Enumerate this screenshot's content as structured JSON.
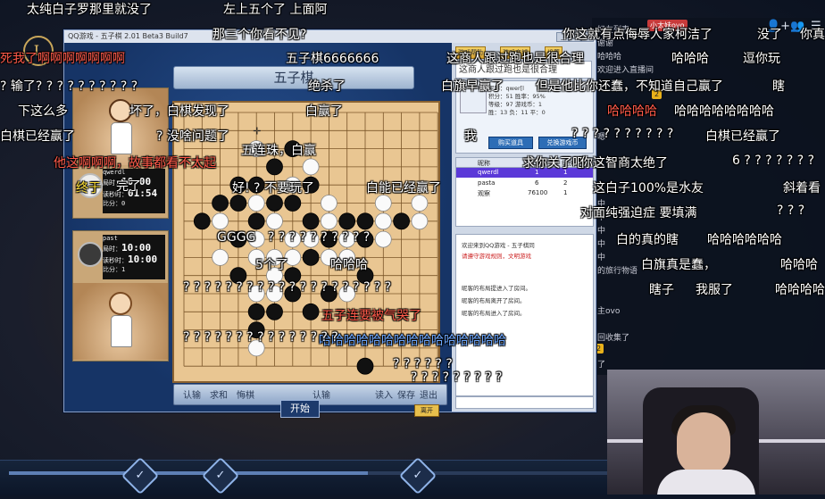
{
  "game": {
    "titlebar": "QQ游戏 - 五子棋  2.01 Beta3 Build7",
    "banner": "五子棋",
    "toolbar": {
      "btn1": "游戏帮助",
      "btn2": "游戏商城",
      "btn3": "设置"
    },
    "ad_text": "这商人跟过跑也是很合理",
    "profile_buttons": [
      "购买道具",
      "兑换游戏币"
    ],
    "profile_lines": [
      "昵称：qwer[l",
      "积分：51  胜率：95%",
      "等级：97  游戏币：1",
      "胜：13  负：11  平：0"
    ],
    "user_list": {
      "headers": [
        "昵称",
        "QQ号",
        "级别"
      ],
      "rows": [
        {
          "name": "qwerdl",
          "qq": "1",
          "lvl": "1"
        },
        {
          "name": "pasta",
          "qq": "6",
          "lvl": "2"
        },
        {
          "name": "观察",
          "qq": "76100",
          "lvl": "1"
        }
      ]
    },
    "messages": [
      "欢迎来到QQ游戏 - 五子棋同",
      "请遵守游戏规则，文明游戏",
      "",
      "昵客的布局提进入了房间。",
      "昵客的布局离开了房间。",
      "昵客的布局进入了房间。"
    ],
    "player_top": {
      "name": "qwerdl",
      "line1": "局时：",
      "time1": "10:00",
      "line2": "读秒时：",
      "time2": "01:54",
      "line3": "比分：0"
    },
    "player_bottom": {
      "name": "past",
      "line1": "局时：",
      "time1": "10:00",
      "line2": "读秒时：",
      "time2": "10:00",
      "line3": "比分：1"
    },
    "bottom_buttons": [
      "认输",
      "求和",
      "悔棋",
      "开始",
      "认输",
      "保存",
      "退出",
      "读入"
    ],
    "start_label": "开始",
    "exit_label": "离开",
    "board_size": 15
  },
  "stones": {
    "black": [
      [
        6,
        2
      ],
      [
        5,
        3
      ],
      [
        3,
        4
      ],
      [
        4,
        4
      ],
      [
        7,
        4
      ],
      [
        2,
        5
      ],
      [
        3,
        5
      ],
      [
        5,
        5
      ],
      [
        6,
        5
      ],
      [
        1,
        6
      ],
      [
        4,
        6
      ],
      [
        7,
        6
      ],
      [
        9,
        6
      ],
      [
        10,
        6
      ],
      [
        12,
        6
      ],
      [
        3,
        7
      ],
      [
        8,
        7
      ],
      [
        10,
        7
      ],
      [
        7,
        8
      ],
      [
        3,
        9
      ],
      [
        6,
        9
      ],
      [
        10,
        9
      ],
      [
        6,
        10
      ],
      [
        8,
        10
      ],
      [
        4,
        11
      ],
      [
        5,
        11
      ],
      [
        7,
        11
      ],
      [
        4,
        12
      ],
      [
        10,
        14
      ],
      [
        10,
        15
      ]
    ],
    "white": [
      [
        4,
        2
      ],
      [
        7,
        3
      ],
      [
        6,
        4
      ],
      [
        4,
        5
      ],
      [
        8,
        5
      ],
      [
        11,
        5
      ],
      [
        13,
        5
      ],
      [
        2,
        6
      ],
      [
        5,
        6
      ],
      [
        8,
        6
      ],
      [
        11,
        6
      ],
      [
        13,
        6
      ],
      [
        4,
        7
      ],
      [
        6,
        7
      ],
      [
        7,
        7
      ],
      [
        9,
        7
      ],
      [
        11,
        7
      ],
      [
        2,
        8
      ],
      [
        4,
        8
      ],
      [
        5,
        8
      ],
      [
        6,
        8
      ],
      [
        8,
        8
      ],
      [
        9,
        8
      ],
      [
        5,
        9
      ],
      [
        4,
        10
      ],
      [
        5,
        10
      ],
      [
        9,
        10
      ],
      [
        4,
        13
      ]
    ],
    "marker": [
      4,
      1
    ]
  },
  "chat_panel": {
    "user": "小太妹ovo",
    "lines": [
      "好友列表",
      "谢谢",
      "哈哈哈",
      "欢迎进入直播间",
      "",
      "",
      "",
      "",
      "嗯",
      "",
      "",
      "",
      "",
      "中",
      "中",
      "中",
      "中",
      "中",
      "的旅行物语",
      "",
      "",
      "主ovo",
      "",
      "回收集了",
      "",
      "了"
    ]
  },
  "danmaku": [
    {
      "t": "太纯白子罗那里就没了",
      "c": ""
    },
    {
      "t": "左上五个了  上面阿",
      "c": ""
    },
    {
      "t": "那三个你看不见?",
      "c": ""
    },
    {
      "t": "你这就有点侮辱人家柯洁了",
      "c": ""
    },
    {
      "t": "没了",
      "c": ""
    },
    {
      "t": "你真",
      "c": ""
    },
    {
      "t": "死我了啊啊啊啊啊啊啊",
      "c": "r"
    },
    {
      "t": "五子棋6666666",
      "c": ""
    },
    {
      "t": "绝杀了",
      "c": ""
    },
    {
      "t": "这商人跟过跑也是很合理",
      "c": ""
    },
    {
      "t": "哈哈哈",
      "c": ""
    },
    {
      "t": "逗你玩",
      "c": ""
    },
    {
      "t": "? 输了? ? ? ? ? ? ? ? ? ?",
      "c": ""
    },
    {
      "t": "白旗早赢了",
      "c": ""
    },
    {
      "t": "但是他比你还蠢，不知道自己赢了",
      "c": ""
    },
    {
      "t": "瞎",
      "c": ""
    },
    {
      "t": "下这么多",
      "c": ""
    },
    {
      "t": "坏了，白棋发现了",
      "c": ""
    },
    {
      "t": "白赢了",
      "c": ""
    },
    {
      "t": "哈哈哈哈",
      "c": "r"
    },
    {
      "t": "哈哈哈哈哈哈哈哈",
      "c": ""
    },
    {
      "t": "白棋已经赢了",
      "c": ""
    },
    {
      "t": "? 没啥问题了",
      "c": ""
    },
    {
      "t": "我",
      "c": ""
    },
    {
      "t": "? ? ? ? ? ? ? ? ? ?",
      "c": ""
    },
    {
      "t": "白棋已经赢了",
      "c": ""
    },
    {
      "t": "五连珠，白赢",
      "c": ""
    },
    {
      "t": "他这啊啊啊，故事都看不太起",
      "c": "r"
    },
    {
      "t": "求你关了吧",
      "c": ""
    },
    {
      "t": "你这智商太绝了",
      "c": ""
    },
    {
      "t": "6 ? ? ? ? ? ? ?",
      "c": ""
    },
    {
      "t": "终于",
      "c": "y"
    },
    {
      "t": "完了",
      "c": ""
    },
    {
      "t": "好! ? 不要玩了",
      "c": ""
    },
    {
      "t": "白能已经赢了",
      "c": ""
    },
    {
      "t": "这白子100%是水友",
      "c": ""
    },
    {
      "t": "斜着看",
      "c": ""
    },
    {
      "t": "对面纯强迫症 要填满",
      "c": ""
    },
    {
      "t": "? ? ?",
      "c": ""
    },
    {
      "t": "GGGG",
      "c": ""
    },
    {
      "t": "? ? ? ? ? ? ? ? ? ?",
      "c": ""
    },
    {
      "t": "白的真的瞎",
      "c": ""
    },
    {
      "t": "哈哈哈哈哈哈",
      "c": ""
    },
    {
      "t": "5个了",
      "c": ""
    },
    {
      "t": "哈哈哈",
      "c": ""
    },
    {
      "t": "白旗真是蠢，",
      "c": ""
    },
    {
      "t": "哈哈哈",
      "c": ""
    },
    {
      "t": "瞎子",
      "c": ""
    },
    {
      "t": "我服了",
      "c": ""
    },
    {
      "t": "哈哈哈哈",
      "c": ""
    },
    {
      "t": "? ? ? ? ? ? ? ? ? ? ? ? ? ? ? ? ? ? ? ?",
      "c": ""
    },
    {
      "t": "五子连要被气哭了",
      "c": "r"
    },
    {
      "t": "哈哈哈哈哈哈哈哈哈哈哈哈哈哈哈",
      "c": "b"
    },
    {
      "t": "? ? ? ? ? ? ? ? ? ? ? ? ? ? ?",
      "c": ""
    },
    {
      "t": "? ? ? ? ? ?",
      "c": ""
    },
    {
      "t": "? ? ? ? ? ? ? ? ?",
      "c": ""
    }
  ]
}
